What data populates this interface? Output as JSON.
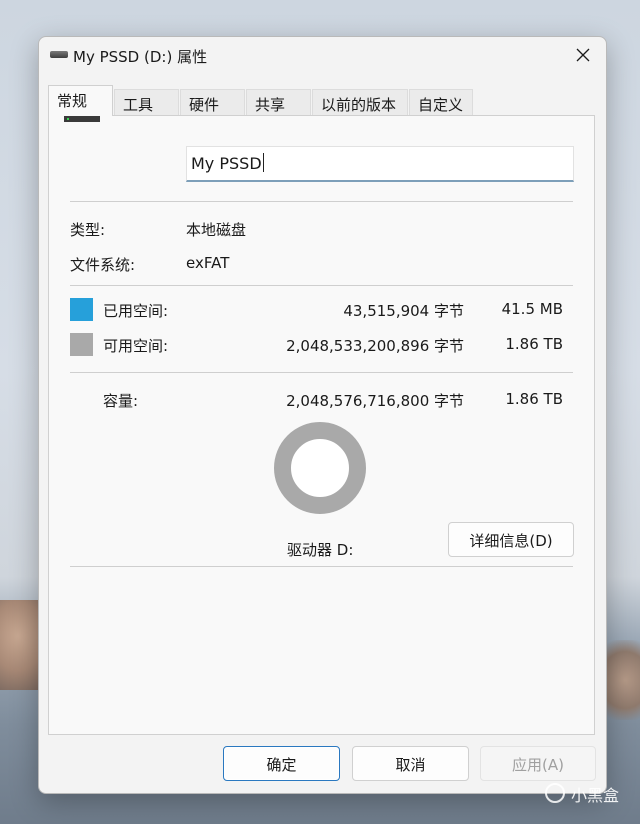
{
  "window": {
    "title": "My PSSD (D:) 属性"
  },
  "tabs": [
    {
      "label": "常规",
      "active": true
    },
    {
      "label": "工具"
    },
    {
      "label": "硬件"
    },
    {
      "label": "共享"
    },
    {
      "label": "以前的版本"
    },
    {
      "label": "自定义"
    }
  ],
  "general": {
    "name_value": "My PSSD",
    "type_label": "类型:",
    "type_value": "本地磁盘",
    "fs_label": "文件系统:",
    "fs_value": "exFAT",
    "used": {
      "label": "已用空间:",
      "bytes": "43,515,904 字节",
      "size": "41.5 MB",
      "color": "#26a0da"
    },
    "free": {
      "label": "可用空间:",
      "bytes": "2,048,533,200,896 字节",
      "size": "1.86 TB",
      "color": "#a9a9a9"
    },
    "capacity": {
      "label": "容量:",
      "bytes": "2,048,576,716,800 字节",
      "size": "1.86 TB"
    },
    "drive_label": "驱动器 D:",
    "details_button": "详细信息(D)",
    "used_fraction": 2e-05
  },
  "footer": {
    "ok": "确定",
    "cancel": "取消",
    "apply": "应用(A)"
  },
  "watermark": {
    "text": "小黑盒"
  },
  "icons": [
    "drive-icon",
    "close-icon",
    "watermark-logo-icon"
  ]
}
